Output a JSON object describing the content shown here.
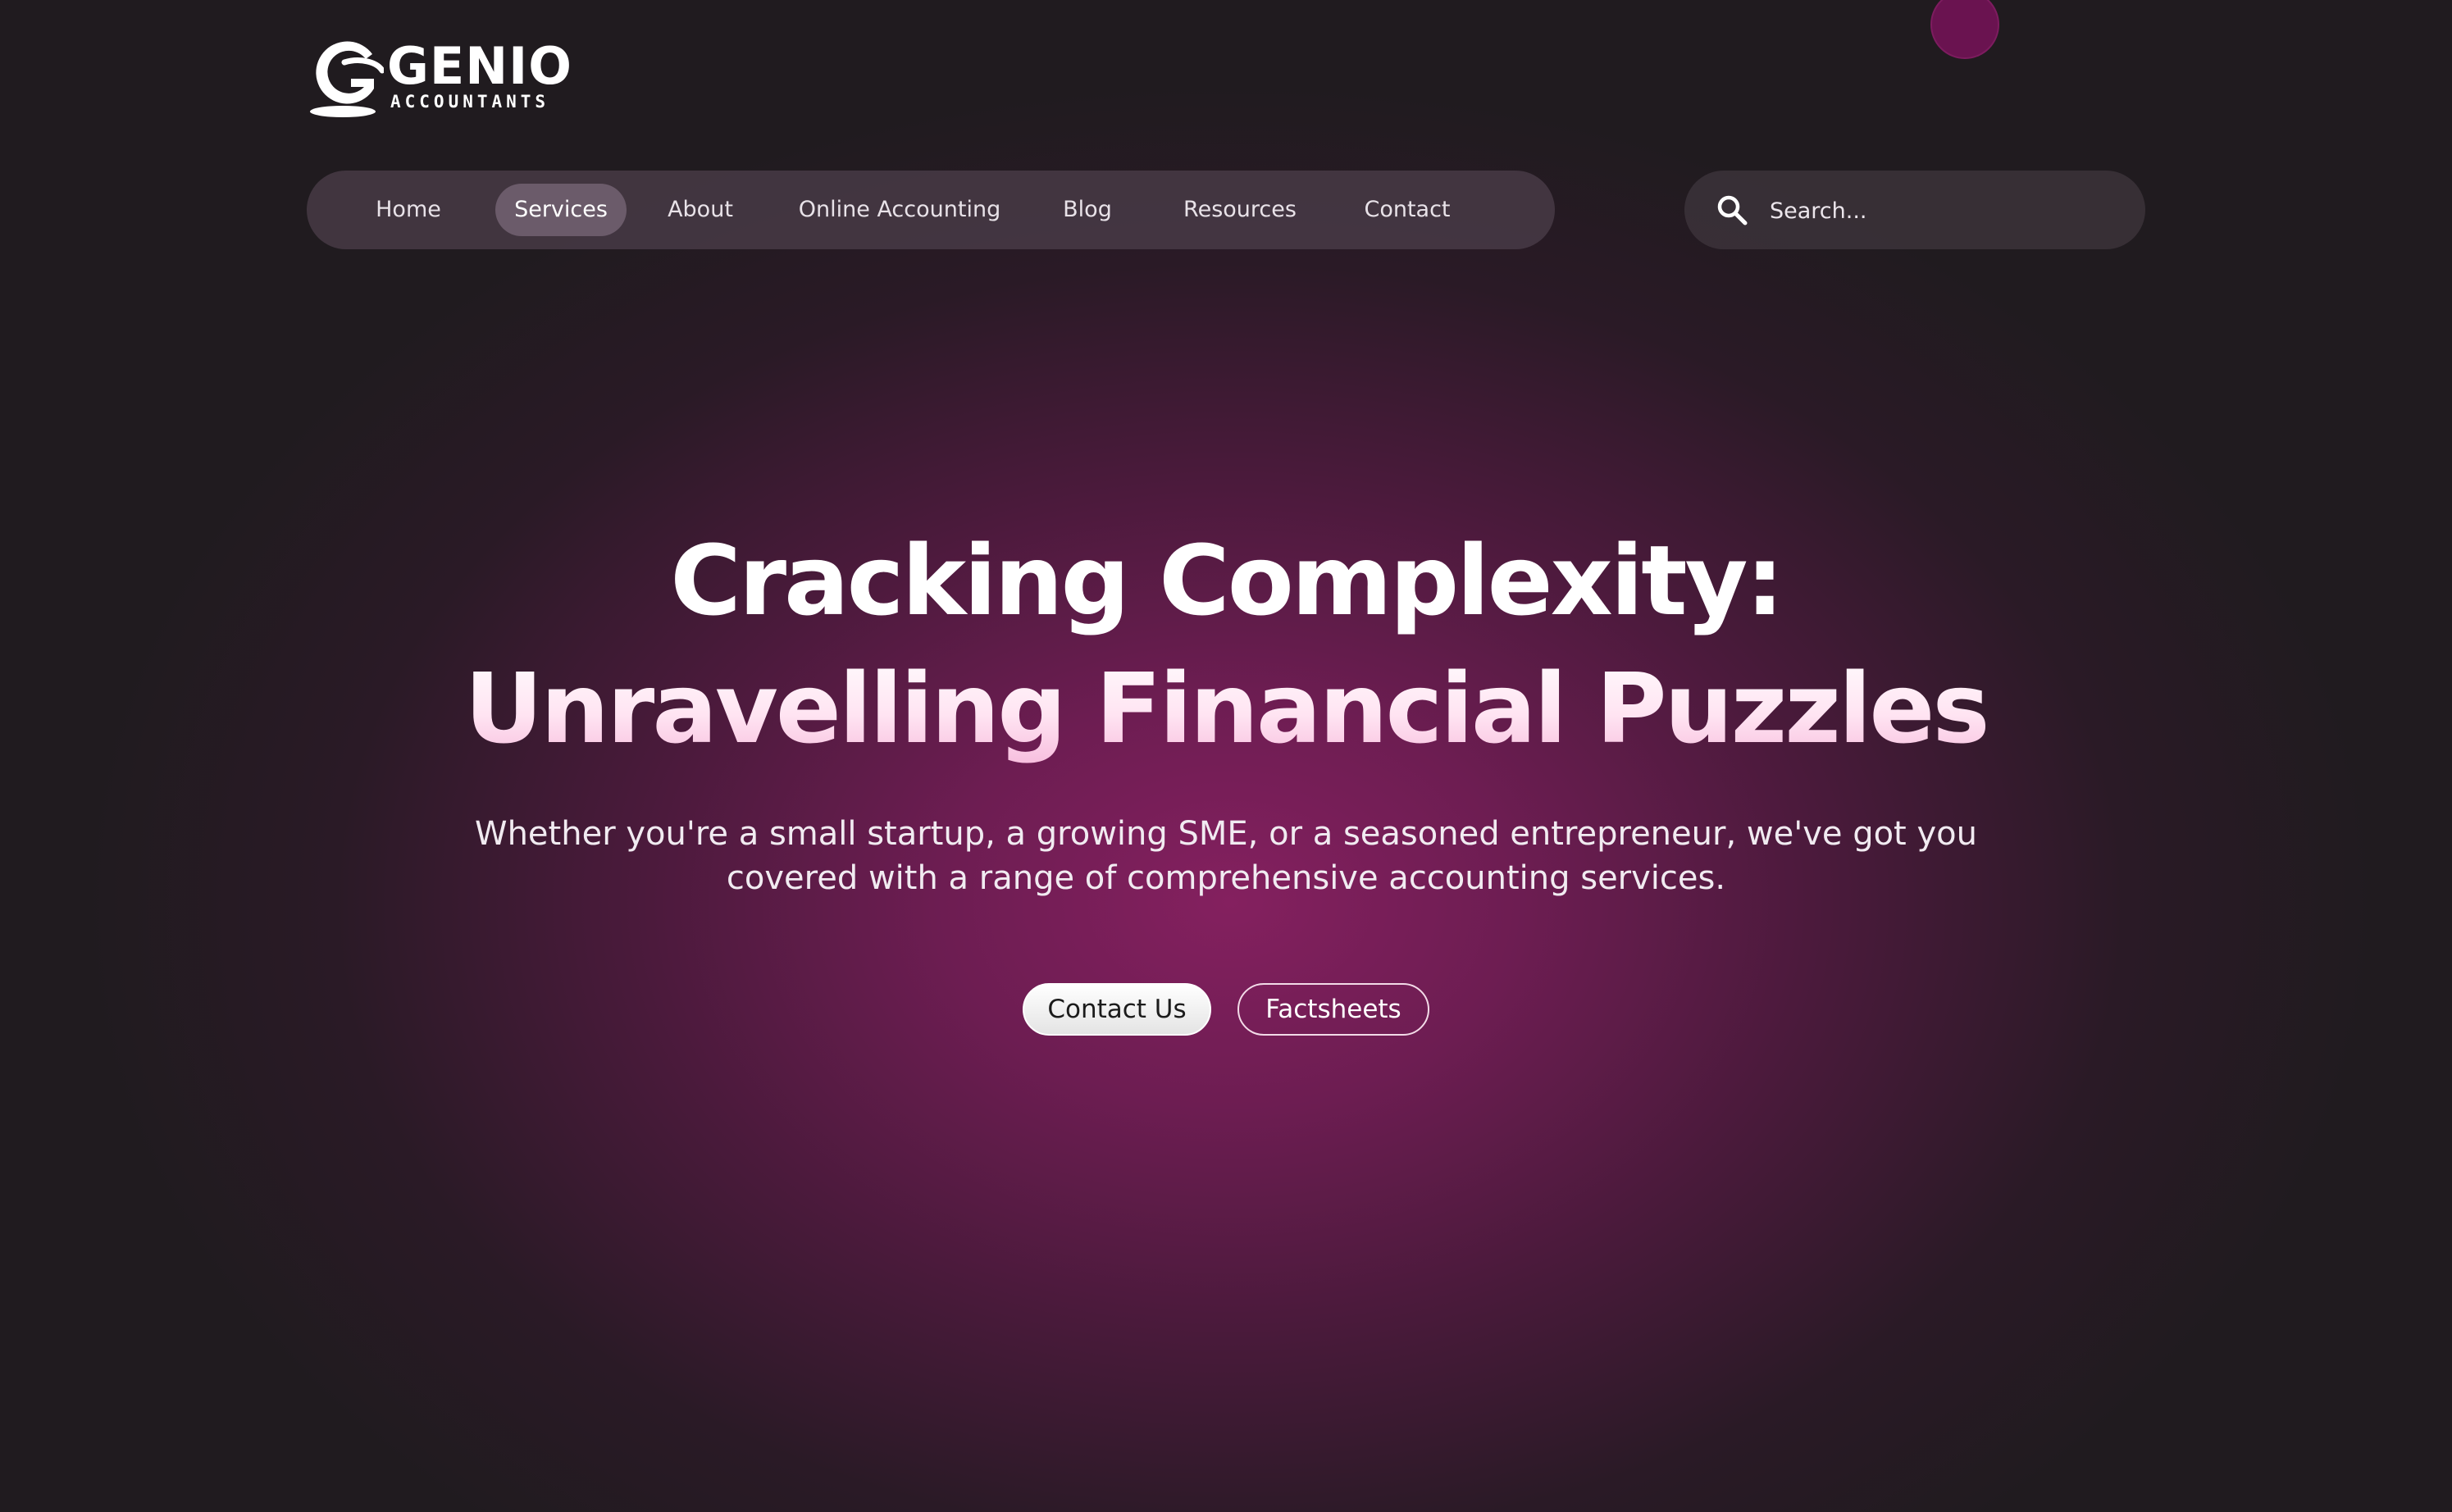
{
  "brand": {
    "name": "GENIO",
    "tagline": "ACCOUNTANTS"
  },
  "nav": {
    "items": [
      {
        "label": "Home",
        "active": false
      },
      {
        "label": "Services",
        "active": true
      },
      {
        "label": "About",
        "active": false
      },
      {
        "label": "Online Accounting",
        "active": false
      },
      {
        "label": "Blog",
        "active": false
      },
      {
        "label": "Resources",
        "active": false
      },
      {
        "label": "Contact",
        "active": false
      }
    ]
  },
  "search": {
    "placeholder": "Search...",
    "icon": "search-icon"
  },
  "hero": {
    "headline_line1": "Cracking Complexity:",
    "headline_line2": "Unravelling Financial Puzzles",
    "subtitle_line1": "Whether you're a small startup, a growing SME, or a seasoned entrepreneur, we've got you",
    "subtitle_line2": "covered with a range of comprehensive accounting services.",
    "primary_button": "Contact Us",
    "secondary_button": "Factsheets"
  },
  "colors": {
    "background": "#1f1b1e",
    "glow": "#84205f",
    "accent_dot": "#6a1350",
    "nav_active": "#6b5b6a"
  }
}
